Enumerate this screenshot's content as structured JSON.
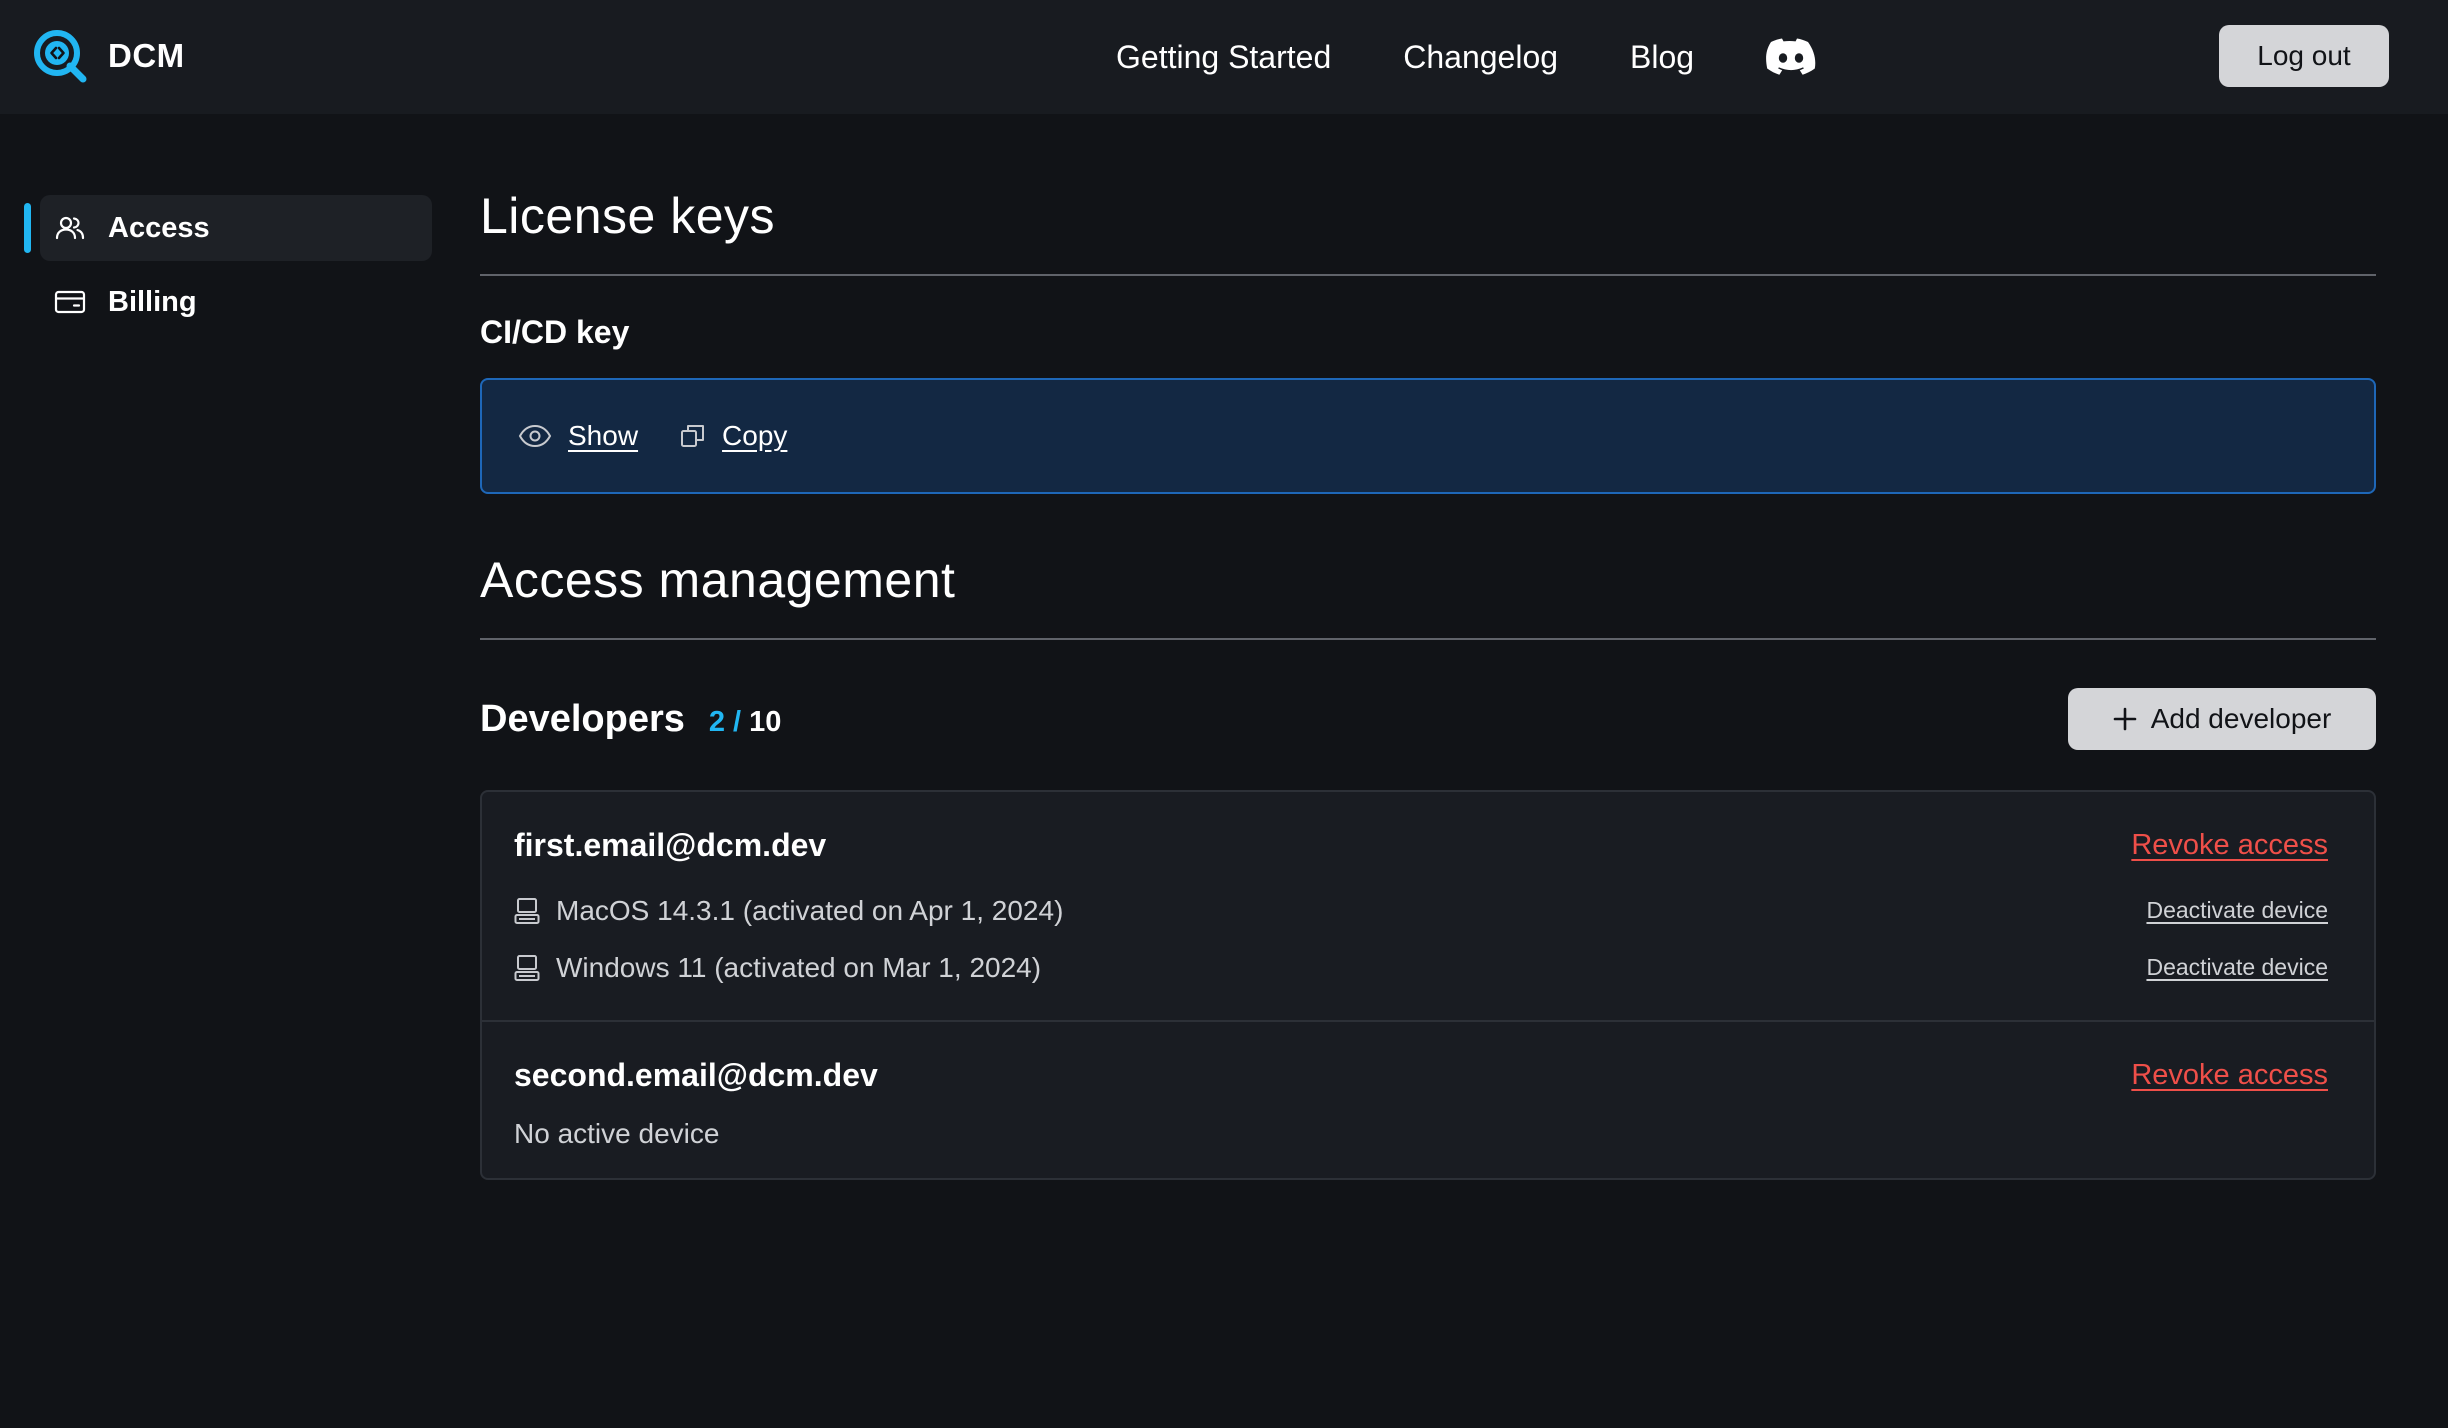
{
  "header": {
    "brand": "DCM",
    "nav": [
      "Getting Started",
      "Changelog",
      "Blog"
    ],
    "logout_label": "Log out"
  },
  "sidebar": {
    "items": [
      {
        "label": "Access",
        "icon": "users-icon",
        "active": true
      },
      {
        "label": "Billing",
        "icon": "credit-card-icon",
        "active": false
      }
    ]
  },
  "license": {
    "title": "License keys",
    "cicd_label": "CI/CD key",
    "show_label": "Show",
    "copy_label": "Copy"
  },
  "access": {
    "title": "Access management",
    "developers_label": "Developers",
    "used": "2",
    "separator": "/",
    "total": "10",
    "add_label": "Add developer",
    "developers": [
      {
        "email": "first.email@dcm.dev",
        "revoke_label": "Revoke access",
        "devices": [
          {
            "text": "MacOS 14.3.1 (activated on Apr 1, 2024)",
            "action": "Deactivate device"
          },
          {
            "text": "Windows 11 (activated on Mar 1, 2024)",
            "action": "Deactivate device"
          }
        ]
      },
      {
        "email": "second.email@dcm.dev",
        "revoke_label": "Revoke access",
        "no_device": "No active device"
      }
    ]
  },
  "colors": {
    "accent": "#21b6f2",
    "danger": "#ef4f49",
    "background": "#111317",
    "key_box": "#132843"
  }
}
